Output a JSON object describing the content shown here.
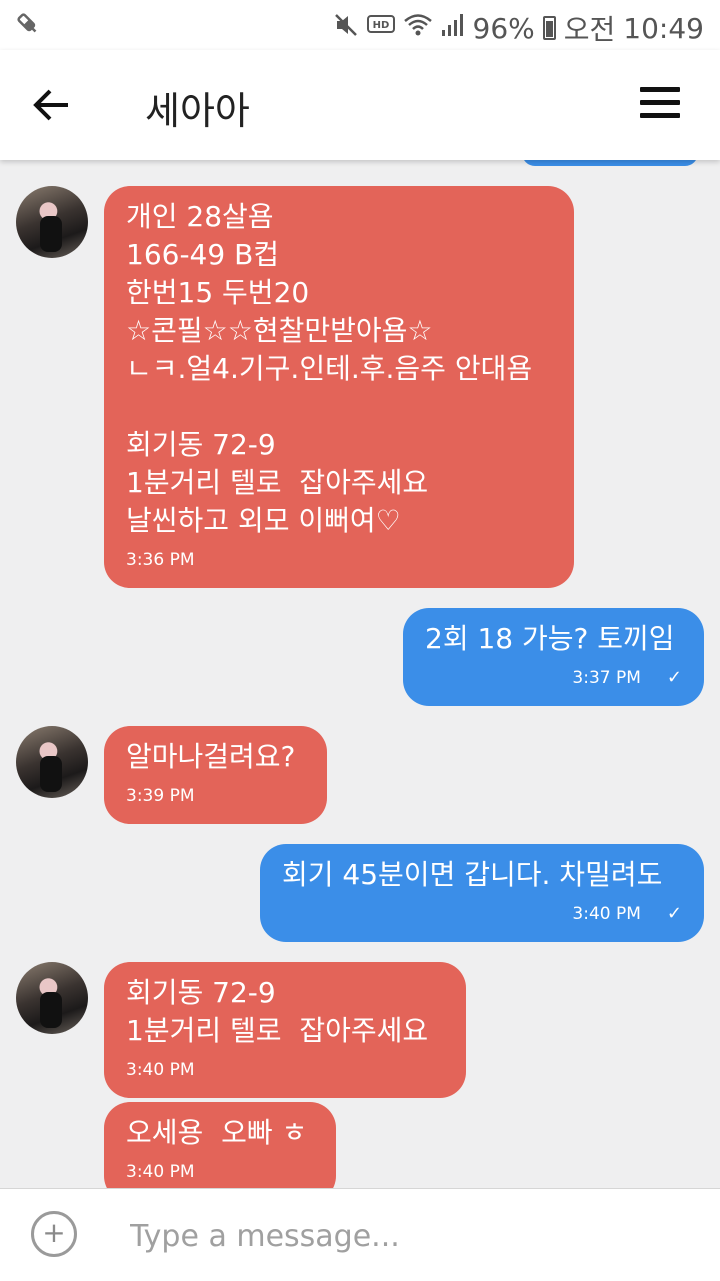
{
  "status_bar": {
    "battery": "96%",
    "ampm": "오전",
    "time": "10:49",
    "icons": [
      "syringe-icon",
      "mute-icon",
      "hd-icon",
      "wifi-icon",
      "signal-icon",
      "battery-icon"
    ]
  },
  "header": {
    "title": "세아아",
    "back_icon": "arrow-left-icon",
    "menu_icon": "hamburger-menu-icon"
  },
  "colors": {
    "incoming": "#e36459",
    "outgoing": "#3b8ee8",
    "background": "#efeff0"
  },
  "messages": [
    {
      "direction": "in",
      "text": "개인 28살욤\n166-49 B컵\n한번15 두번20\n☆콘필☆☆현찰만받아욤☆\nㄴㅋ.얼4.기구.인테.후.음주 안대욤\n\n회기동 72-9\n1분거리 텔로  잡아주세요\n날씬하고 외모 이뻐여♡",
      "time": "3:36 PM"
    },
    {
      "direction": "out",
      "text": "2회 18 가능? 토끼임",
      "time": "3:37 PM",
      "status": "✓"
    },
    {
      "direction": "in",
      "text": "알마나걸려요?",
      "time": "3:39 PM"
    },
    {
      "direction": "out",
      "text": "회기 45분이면 갑니다. 차밀려도",
      "time": "3:40 PM",
      "status": "✓"
    },
    {
      "direction": "in",
      "text": "회기동 72-9\n1분거리 텔로  잡아주세요",
      "time": "3:40 PM"
    },
    {
      "direction": "in",
      "text": "오세용  오빠 ㅎ",
      "time": "3:40 PM"
    }
  ],
  "composer": {
    "placeholder": "Type a message...",
    "add_icon": "plus-circle-icon"
  }
}
